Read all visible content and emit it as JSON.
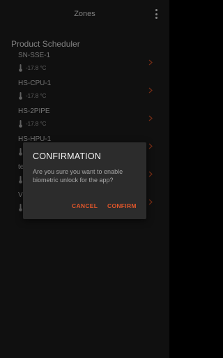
{
  "header": {
    "title": "Zones"
  },
  "section": {
    "title": "Product Scheduler"
  },
  "zones": [
    {
      "name": "SN-SSE-1",
      "temp": "-17.8 °C"
    },
    {
      "name": "HS-CPU-1",
      "temp": "-17.8 °C"
    },
    {
      "name": "HS-2PIPE",
      "temp": "-17.8 °C"
    },
    {
      "name": "HS-HPU-1",
      "temp": ""
    },
    {
      "name": "te",
      "temp": ""
    },
    {
      "name": "V",
      "temp": ""
    }
  ],
  "dialog": {
    "title": "CONFIRMATION",
    "message": "Are you sure you want to enable biometric unlock for the app?",
    "cancel_label": "CANCEL",
    "confirm_label": "CONFIRM"
  },
  "colors": {
    "accent": "#e0562a",
    "background": "#1f1f1f",
    "dialog": "#2c2c2c"
  },
  "icons": {
    "menu": "more-vertical-icon",
    "thermometer": "thermometer-icon",
    "chevron": "chevron-right-icon"
  }
}
